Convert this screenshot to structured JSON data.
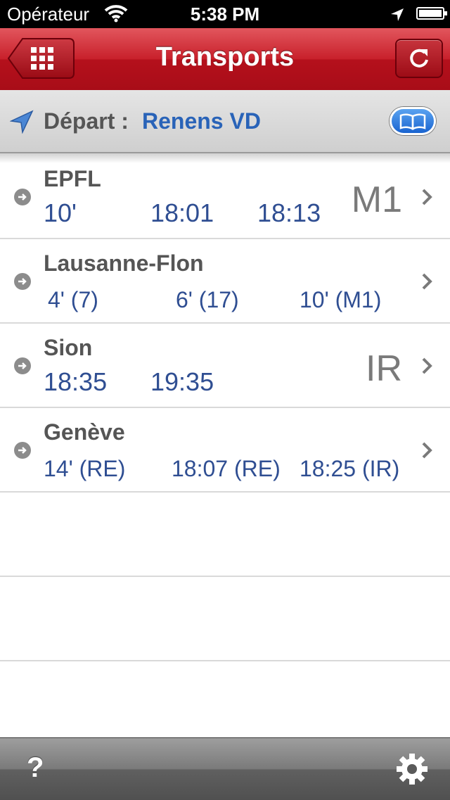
{
  "status_bar": {
    "carrier": "Opérateur",
    "time": "5:38 PM"
  },
  "nav": {
    "title": "Transports",
    "back_icon": "grid-icon",
    "refresh_icon": "refresh-icon"
  },
  "departure": {
    "label": "Départ :",
    "station": "Renens VD",
    "bookmark_icon": "book-icon"
  },
  "destinations": [
    {
      "name": "EPFL",
      "times": [
        "10'",
        "18:01",
        "18:13"
      ],
      "line": "M1"
    },
    {
      "name": "Lausanne-Flon",
      "times": [
        "4' (7)",
        "6' (17)",
        "10' (M1)"
      ],
      "line": ""
    },
    {
      "name": "Sion",
      "times": [
        "18:35",
        "19:35"
      ],
      "line": "IR"
    },
    {
      "name": "Genève",
      "times": [
        "14' (RE)",
        "18:07 (RE)",
        "18:25 (IR)"
      ],
      "line": ""
    }
  ],
  "toolbar": {
    "help_label": "?",
    "settings_icon": "gear-icon"
  },
  "colors": {
    "nav_red": "#c8202b",
    "link_blue": "#2963b8",
    "time_blue": "#2f4e92"
  }
}
